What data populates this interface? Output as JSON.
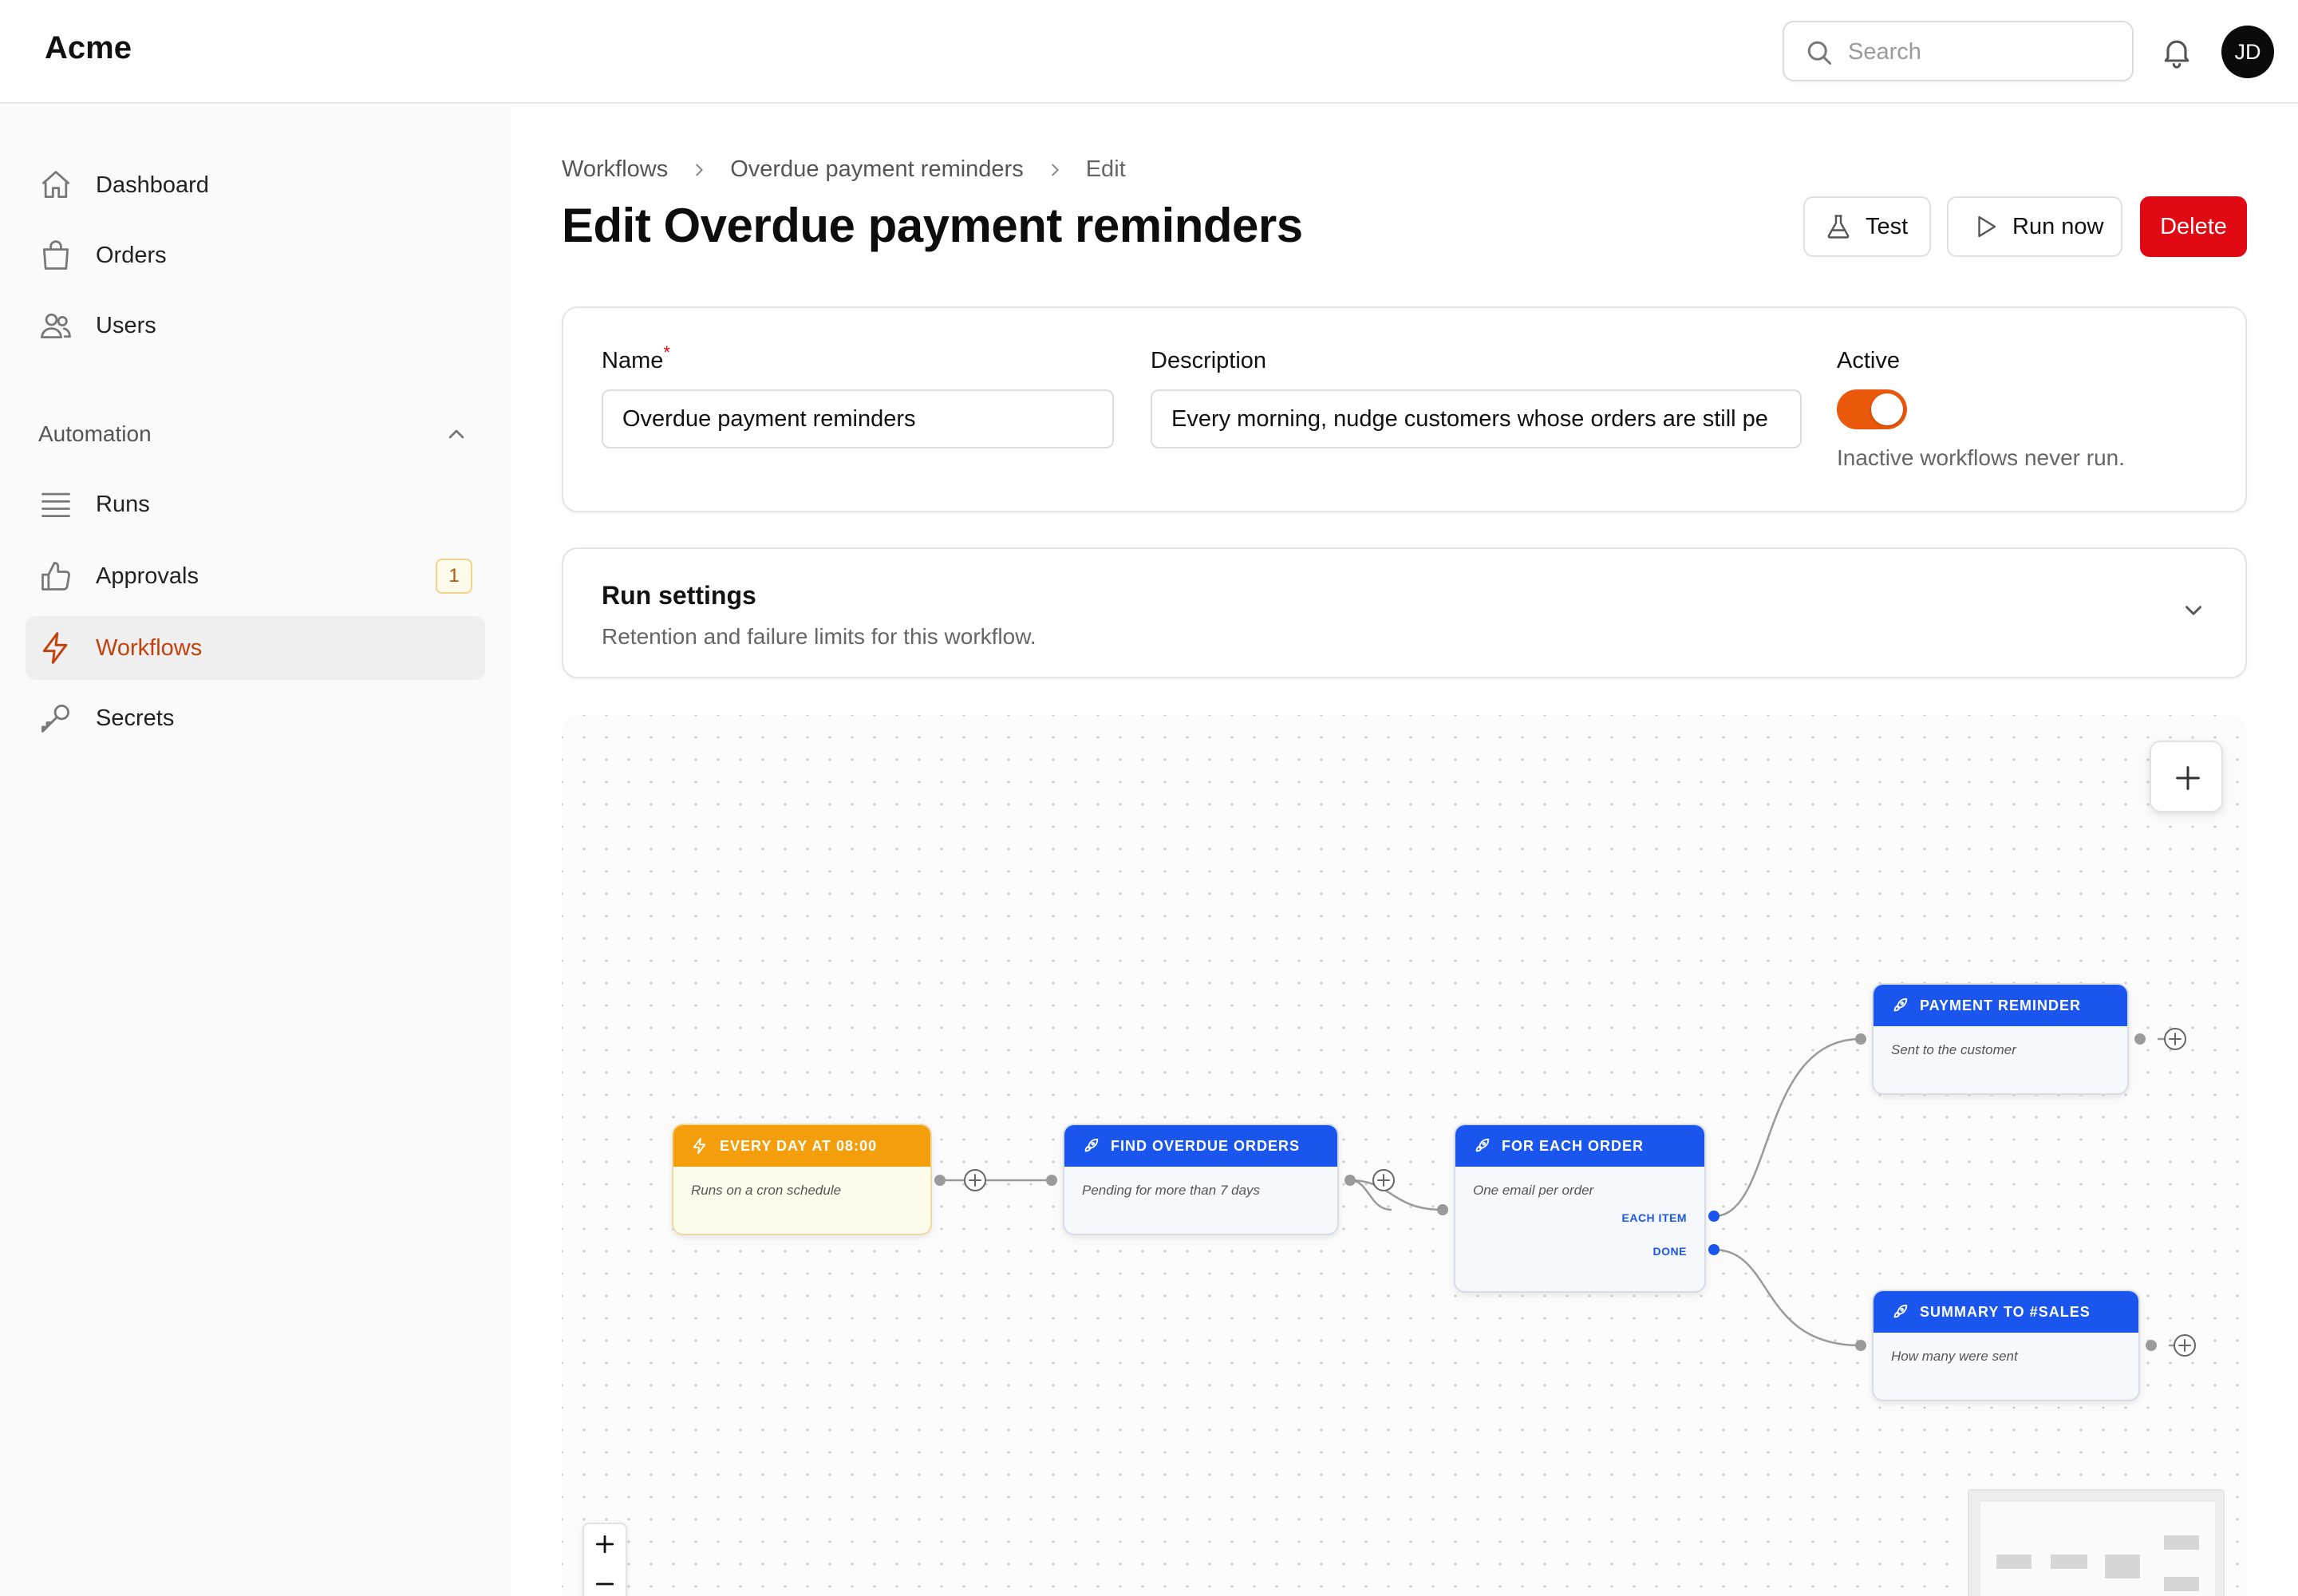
{
  "app": {
    "brand": "Acme"
  },
  "topbar": {
    "search_placeholder": "Search",
    "search_icon": "search-icon",
    "bell_icon": "bell-icon",
    "avatar_initials": "JD"
  },
  "sidebar": {
    "items": [
      {
        "label": "Dashboard",
        "icon": "home-icon"
      },
      {
        "label": "Orders",
        "icon": "shopping-bag-icon"
      },
      {
        "label": "Users",
        "icon": "users-icon"
      }
    ],
    "section": {
      "label": "Automation",
      "expanded": true
    },
    "automation_items": [
      {
        "label": "Runs",
        "icon": "list-icon"
      },
      {
        "label": "Approvals",
        "icon": "thumbs-up-icon",
        "badge": "1"
      },
      {
        "label": "Workflows",
        "icon": "bolt-icon",
        "active": true
      },
      {
        "label": "Secrets",
        "icon": "key-icon"
      }
    ]
  },
  "breadcrumb": [
    "Workflows",
    "Overdue payment reminders",
    "Edit"
  ],
  "page": {
    "title": "Edit Overdue payment reminders",
    "actions": {
      "test": "Test",
      "run_now": "Run now",
      "delete": "Delete"
    }
  },
  "form": {
    "name_label": "Name",
    "name_required_mark": "*",
    "name_value": "Overdue payment reminders",
    "description_label": "Description",
    "description_value": "Every morning, nudge customers whose orders are still pe",
    "active_label": "Active",
    "active": true,
    "active_help": "Inactive workflows never run."
  },
  "run_settings": {
    "title": "Run settings",
    "subtitle": "Retention and failure limits for this workflow.",
    "expanded": false
  },
  "flow": {
    "nodes": [
      {
        "id": "trigger",
        "title": "EVERY DAY AT 08:00",
        "subtitle": "Runs on a cron schedule",
        "kind": "trigger"
      },
      {
        "id": "find",
        "title": "FIND OVERDUE ORDERS",
        "subtitle": "Pending for more than 7 days",
        "kind": "action"
      },
      {
        "id": "loop",
        "title": "FOR EACH ORDER",
        "subtitle": "One email per order",
        "kind": "action",
        "outputs": [
          "EACH ITEM",
          "DONE"
        ]
      },
      {
        "id": "reminder",
        "title": "PAYMENT REMINDER",
        "subtitle": "Sent to the customer",
        "kind": "action"
      },
      {
        "id": "summary",
        "title": "SUMMARY TO #SALES",
        "subtitle": "How many were sent",
        "kind": "action"
      }
    ]
  },
  "colors": {
    "accent": "#ea580c",
    "active_nav": "#c2410c",
    "danger": "#e00812",
    "node_blue": "#1a56ee",
    "trigger_orange": "#f59e0b"
  }
}
